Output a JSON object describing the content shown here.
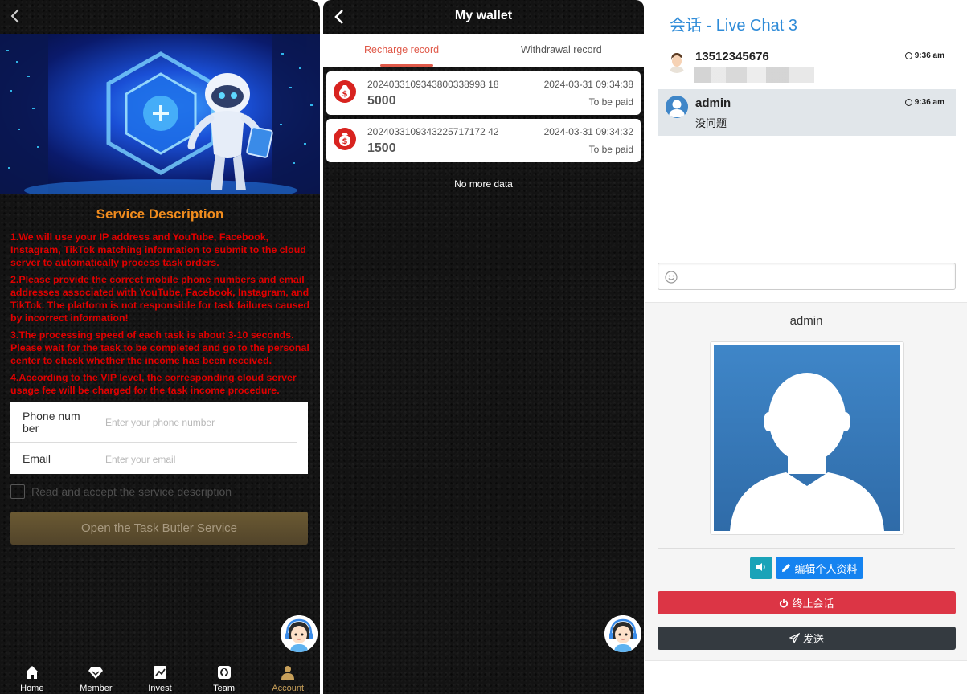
{
  "panel1": {
    "section_title": "Service Description",
    "rules": [
      "1.We will use your IP address and YouTube, Facebook, Instagram, TikTok matching information to submit to the cloud server to automatically process task orders.",
      "2.Please provide the correct mobile phone numbers and email addresses associated with YouTube, Facebook, Instagram, and TikTok. The platform is not responsible for task failures caused by incorrect information!",
      "3.The processing speed of each task is about 3-10 seconds. Please wait for the task to be completed and go to the personal center to check whether the income has been received.",
      "4.According to the VIP level, the corresponding cloud server usage fee will be charged for the task income procedure."
    ],
    "phone_label": "Phone num ber",
    "phone_placeholder": "Enter your phone number",
    "email_label": "Email",
    "email_placeholder": "Enter your email",
    "agree_text": "Read and accept the service description",
    "open_button": "Open the Task Butler Service",
    "tabbar": [
      {
        "label": "Home",
        "icon": "home-icon"
      },
      {
        "label": "Member",
        "icon": "diamond-icon"
      },
      {
        "label": "Invest",
        "icon": "chart-icon"
      },
      {
        "label": "Team",
        "icon": "team-icon"
      },
      {
        "label": "Account",
        "icon": "user-icon",
        "active": true
      }
    ],
    "accent_color": "#f08c1e",
    "rule_color": "#e00000"
  },
  "panel2": {
    "title": "My wallet",
    "tabs": [
      "Recharge record",
      "Withdrawal record"
    ],
    "active_tab": 0,
    "records": [
      {
        "order_no": "2024033109343800338998 18",
        "datetime": "2024-03-31 09:34:38",
        "amount": "5000",
        "status": "To be paid"
      },
      {
        "order_no": "2024033109343225717172 42",
        "datetime": "2024-03-31 09:34:32",
        "amount": "1500",
        "status": "To be paid"
      }
    ],
    "no_more": "No more data"
  },
  "panel3": {
    "title": "会话 - Live Chat 3",
    "messages": [
      {
        "name": "13512345676",
        "time": "9:36 am",
        "text": ""
      },
      {
        "name": "admin",
        "time": "9:36 am",
        "text": "没问题"
      }
    ],
    "input_placeholder": "",
    "profile_name": "admin",
    "edit_button": "编辑个人资料",
    "end_button": "终止会话",
    "send_button": "发送",
    "colors": {
      "link": "#2e8bd8",
      "edit": "#1583f0",
      "end": "#dc3545",
      "send": "#343a40",
      "sound": "#1aa3b8"
    }
  }
}
